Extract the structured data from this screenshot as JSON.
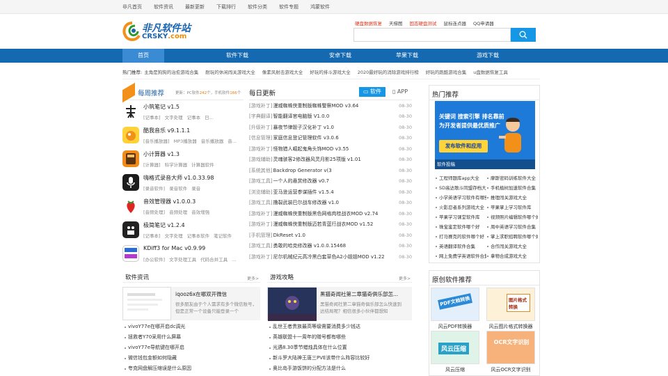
{
  "topbar": {
    "links": [
      "非凡首页",
      "软件资讯",
      "最新更新",
      "下载排行",
      "软件分类",
      "软件专题",
      "鸿蒙软件"
    ]
  },
  "logo": {
    "cn": "非凡软件站",
    "en_a": "CRSKY",
    "en_b": ".com"
  },
  "header": {
    "hotlinks": [
      "硬盘数据恢复",
      "天梯图",
      "固态硬盘测试",
      "鼠标连点器",
      "QQ申请器"
    ]
  },
  "nav": {
    "items": [
      "首页",
      "软件下载",
      "安卓下载",
      "苹果下载",
      "游戏下载"
    ]
  },
  "hot": {
    "label": "热门推荐:",
    "items": [
      "主角是狗狗的治愈游戏合集",
      "耐玩的休闲闯关游戏大全",
      "像素风射击游戏大全",
      "好玩的排斗游戏大全",
      "2020最好玩的消除游戏排行榜",
      "好玩的跑酷游戏合集",
      "u盘数据恢复工具"
    ]
  },
  "weekly": {
    "title": "每周推荐",
    "sub_pre": "更新：PC软件",
    "pc_count": "242",
    "sub_mid": "个，手机软件",
    "mobile_count": "166",
    "sub_post": "个",
    "items": [
      {
        "name": "小筑笔记 v1.5",
        "tags": [
          "[记事本]",
          "文字处理",
          "记事本",
          "日..."
        ]
      },
      {
        "name": "酷我音乐 v9.1.1.1",
        "tags": [
          "[音乐播放器]",
          "MP3播放器",
          "音乐播放器",
          "音..."
        ]
      },
      {
        "name": "小计算器 v1.3",
        "tags": [
          "[计算器]",
          "科学计算器",
          "计算器软件"
        ]
      },
      {
        "name": "嗨格式录音大师 v1.0.33.98",
        "tags": [
          "[录音软件]",
          "录音软件",
          "录音"
        ]
      },
      {
        "name": "音效管理器 v1.0.0.3",
        "tags": [
          "[音频处理]",
          "音频处理",
          "音效增强"
        ]
      },
      {
        "name": "极简笔记 v1.2.4",
        "tags": [
          "[记事本]",
          "文字处理",
          "记事本软件",
          "笔记软件"
        ]
      },
      {
        "name": "KDiff3 for Mac v0.9.99",
        "tags": [
          "[办公软件]",
          "文字处理工具",
          "代码合并工具",
          "..."
        ]
      }
    ]
  },
  "daily": {
    "title": "每日更新",
    "tab_soft": "软件",
    "tab_app": "APP",
    "rows": [
      {
        "cat": "[游戏补丁]",
        "title": "漫威蜘蛛侠重制版蜘蛛警察MOD v3.64",
        "date": "08-30"
      },
      {
        "cat": "[字典翻译]",
        "title": "智能翻译官电脑版 V1.0.0",
        "date": "08-30"
      },
      {
        "cat": "[升级补丁]",
        "title": "暴夜节律骰子汉化补丁 v1.0",
        "date": "08-30"
      },
      {
        "cat": "[信息管理]",
        "title": "家庭信息登记管理软件 v3.0.6",
        "date": "08-30"
      },
      {
        "cat": "[游戏补丁]",
        "title": "怪物猎人崛起鬼角头饰MOD v3.55",
        "date": "08-30"
      },
      {
        "cat": "[游戏辅助]",
        "title": "灵魂骇客2修改器风灵月影25项版 v1.01",
        "date": "08-30"
      },
      {
        "cat": "[系统其他]",
        "title": "Backdrop Generator v(3",
        "date": "08-30"
      },
      {
        "cat": "[游戏工具]",
        "title": "一个人的悬赏修改器 v0.7",
        "date": "08-30"
      },
      {
        "cat": "[浏览辅助]",
        "title": "亚马逊运营参谋插件 v1.5.4",
        "date": "08-30"
      },
      {
        "cat": "[游戏工具]",
        "title": "撸裂武装巴尔战车修改器 v1.0",
        "date": "08-30"
      },
      {
        "cat": "[游戏补丁]",
        "title": "漫威蜘蛛侠重制版黑色网格肉桂战衣MOD v2.74",
        "date": "08-30"
      },
      {
        "cat": "[游戏补丁]",
        "title": "漫威蜘蛛侠重制版迈若青蓝行战衣MOD v1.52",
        "date": "08-30"
      },
      {
        "cat": "[手机管理]",
        "title": "DkReset v1.0",
        "date": "08-30"
      },
      {
        "cat": "[游戏工具]",
        "title": "勇敢的哈克修改器 v1.0.0.15468",
        "date": "08-30"
      },
      {
        "cat": "[游戏补丁]",
        "title": "尼尔机械纪元高冷黑白套草色A2小姐姐MOD v1.22",
        "date": "08-30"
      }
    ]
  },
  "news": {
    "title": "软件资讯",
    "more": "更多>",
    "feat_title": "iqooz6x在哪双开微信",
    "feat_desc": "很多朋友由于个人需求有多个微信账号，但是正常一个设备只能登录一个",
    "items": [
      "vivoY77e在哪开启dc调光",
      "拯救者Y70采用什么屏幕",
      "vivoY77e导航键在哪开启",
      "微信钱包金额如何隐藏",
      "夸克网盘解压缩误是什么原因"
    ]
  },
  "guides": {
    "title": "游戏攻略",
    "more": "更多>",
    "feat_title": "黑猫奇闻社第二章猫奇俱乐部怎...",
    "feat_desc": "黑猫奇闻社第二章猫奇俱乐部怎么快速到达结局呢？相信很多小伙伴都想知",
    "items": [
      "乱世王者贵族最高等级需要消费多少钱达",
      "英雄联盟十一周年的赠号都有哪些",
      "光遇8.30季节蜡烛具体在什么位置",
      "新斗罗大陆神王唐三PVE该带什么阵容比较好",
      "奥比岛手游饭饼的分配方法是什么"
    ]
  },
  "side": {
    "title": "热门推荐",
    "banner_l1": "关键词  搜索引擎  排名靠前",
    "banner_l2": "为开发者提供最优质推广",
    "banner_btn": "发布软件和应用",
    "banner_cap": "软件投稿",
    "links": [
      "工程师题库app大全",
      "摩斯密码训练软件大全",
      "SD高达歌斗同盟存档大全",
      "手机植树加速软件合集",
      "小学英语学习软件有哪些",
      "推理闯关游戏大全",
      "火影忍者系列游戏大全",
      "苹果掌上学习软件库",
      "苹果学习课堂软件库",
      "视频照片编辑软件哪个好",
      "珠宝鉴定软件哪个好",
      "周中英语学习软件合集",
      "打马赛克的软件哪个好",
      "掌上求职招聘软件哪个好",
      "英语翻译软件合集",
      "合作闯关游戏大全",
      "网上免费学英语软件合集",
      "拿物合成游戏大全"
    ]
  },
  "orig": {
    "title": "原创软件推荐",
    "cards": [
      {
        "label": "风云PDF转换器",
        "pic": "PDF文档转换"
      },
      {
        "label": "风云图片格式转换器",
        "pic": "图片格式转换"
      },
      {
        "label": "风云压缩",
        "pic": "风云压缩"
      },
      {
        "label": "风云OCR文字识别",
        "pic": "OCR文字识别"
      }
    ]
  },
  "colors": {
    "brand_blue": "#1569b0",
    "accent_blue": "#1597e5",
    "orange": "#f27a00",
    "red_link": "#e0321a"
  }
}
